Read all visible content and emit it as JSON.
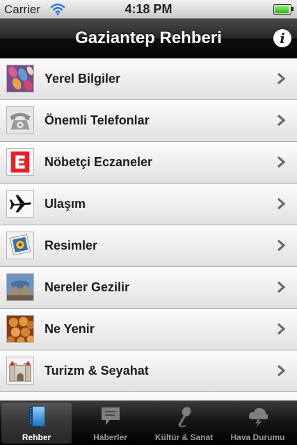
{
  "status": {
    "carrier": "Carrier",
    "time": "4:18 PM",
    "battery_level": 1.0
  },
  "navbar": {
    "title": "Gaziantep Rehberi",
    "info_glyph": "i"
  },
  "list": {
    "items": [
      {
        "label": "Yerel Bilgiler",
        "icon": "fabric-pattern-icon"
      },
      {
        "label": "Önemli Telefonlar",
        "icon": "telephone-icon"
      },
      {
        "label": "Nöbetçi Eczaneler",
        "icon": "pharmacy-e-icon"
      },
      {
        "label": "Ulaşım",
        "icon": "airplane-icon"
      },
      {
        "label": "Resimler",
        "icon": "photo-icon"
      },
      {
        "label": "Nereler Gezilir",
        "icon": "landmark-photo-icon"
      },
      {
        "label": "Ne Yenir",
        "icon": "food-icon"
      },
      {
        "label": "Turizm & Seyahat",
        "icon": "castle-icon"
      }
    ]
  },
  "tabbar": {
    "tabs": [
      {
        "label": "Rehber",
        "icon": "book-icon",
        "active": true
      },
      {
        "label": "Haberler",
        "icon": "speech-bubble-icon",
        "active": false
      },
      {
        "label": "Kültür & Sanat",
        "icon": "microphone-icon",
        "active": false
      },
      {
        "label": "Hava Durumu",
        "icon": "weather-cloud-icon",
        "active": false
      }
    ]
  },
  "colors": {
    "nav_bg": "#1a1a1a",
    "pharmacy_red": "#e0232a",
    "accent_blue": "#4a9fe0"
  }
}
